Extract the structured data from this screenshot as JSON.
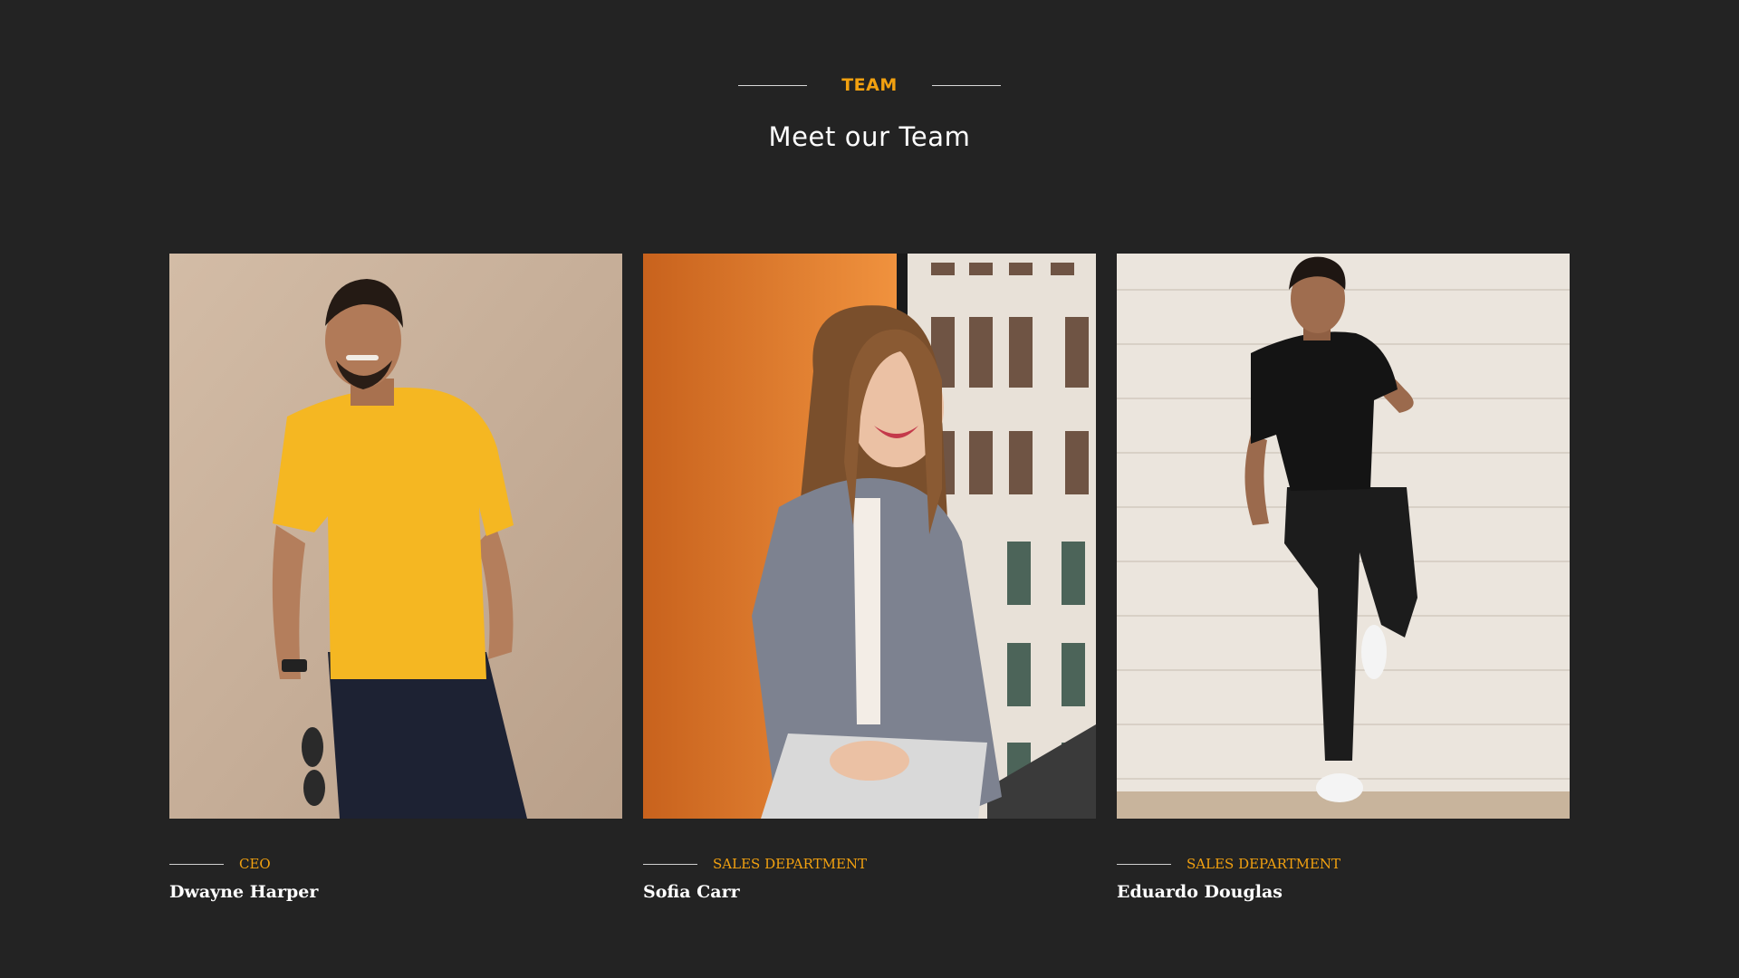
{
  "section": {
    "eyebrow": "TEAM",
    "title": "Meet our Team"
  },
  "members": [
    {
      "role": "CEO",
      "name": "Dwayne Harper"
    },
    {
      "role": "SALES DEPARTMENT",
      "name": "Sofia Carr"
    },
    {
      "role": "SALES DEPARTMENT",
      "name": "Eduardo Douglas"
    }
  ],
  "colors": {
    "background": "#232323",
    "accent": "#f2a110",
    "text": "#ffffff"
  }
}
